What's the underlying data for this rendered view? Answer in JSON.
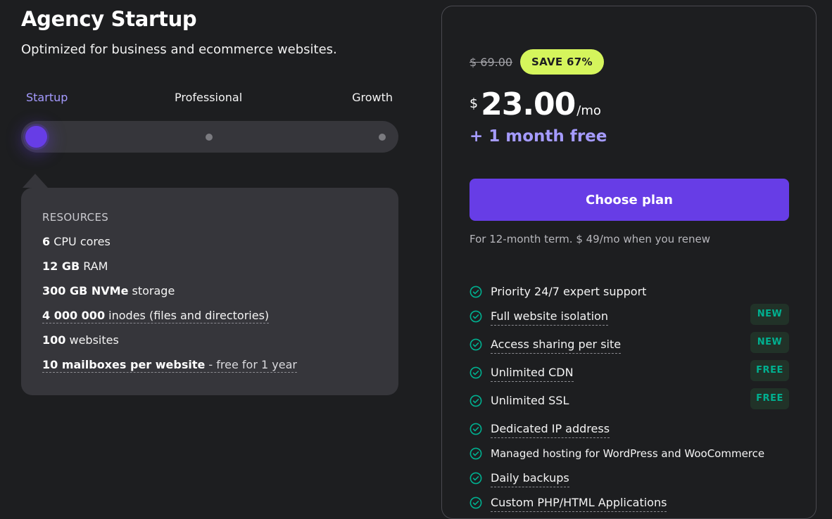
{
  "plan": {
    "title": "Agency Startup",
    "subtitle": "Optimized for business and ecommerce websites."
  },
  "tiers": [
    {
      "label": "Startup",
      "selected": true
    },
    {
      "label": "Professional",
      "selected": false
    },
    {
      "label": "Growth",
      "selected": false
    }
  ],
  "resources": {
    "heading": "RESOURCES",
    "items": [
      {
        "value": "6",
        "text": " CPU cores"
      },
      {
        "value": "12 GB",
        "text": " RAM"
      },
      {
        "value": "300 GB NVMe",
        "text": " storage"
      },
      {
        "value": "4 000 000",
        "text": " inodes (files and directories)"
      },
      {
        "value": "100",
        "text": " websites"
      },
      {
        "value": "10 mailboxes per website",
        "text": " - free for 1 year"
      }
    ]
  },
  "pricing": {
    "old_price": "$ 69.00",
    "save_badge": "SAVE 67%",
    "currency": "$",
    "amount": "23.00",
    "period": "/mo",
    "bonus": "+ 1 month free",
    "cta": "Choose plan",
    "term_note": "For 12-month term. $ 49/mo when you renew"
  },
  "features": [
    {
      "label": "Priority 24/7 expert support",
      "tag": ""
    },
    {
      "label": "Full website isolation",
      "tag": "NEW"
    },
    {
      "label": "Access sharing per site",
      "tag": "NEW"
    },
    {
      "label": "Unlimited CDN",
      "tag": "FREE"
    },
    {
      "label": "Unlimited SSL",
      "tag": "FREE"
    },
    {
      "label": "Dedicated IP address",
      "tag": ""
    },
    {
      "label": "Managed hosting for WordPress and WooCommerce",
      "tag": ""
    },
    {
      "label": "Daily backups",
      "tag": ""
    },
    {
      "label": "Custom PHP/HTML Applications",
      "tag": ""
    }
  ],
  "colors": {
    "background": "#1d1e20",
    "accent": "#673de6",
    "accent_text": "#a59bff",
    "save_badge": "#d5f55c",
    "check_icon": "#00b090"
  }
}
